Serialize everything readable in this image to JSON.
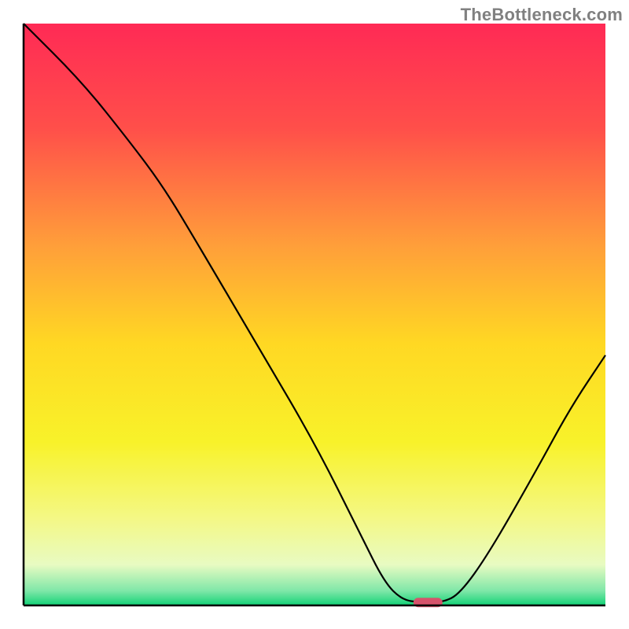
{
  "watermark": "TheBottleneck.com",
  "chart_data": {
    "type": "line",
    "title": "",
    "xlabel": "",
    "ylabel": "",
    "xlim": [
      0,
      100
    ],
    "ylim": [
      0,
      100
    ],
    "grid": false,
    "legend": false,
    "background_gradient": [
      {
        "stop": 0.0,
        "color": "#ff2a55"
      },
      {
        "stop": 0.18,
        "color": "#ff4f4a"
      },
      {
        "stop": 0.38,
        "color": "#ff9e3a"
      },
      {
        "stop": 0.55,
        "color": "#ffd823"
      },
      {
        "stop": 0.72,
        "color": "#f8f22a"
      },
      {
        "stop": 0.85,
        "color": "#f4f885"
      },
      {
        "stop": 0.93,
        "color": "#e8fbc2"
      },
      {
        "stop": 0.975,
        "color": "#7fe7a8"
      },
      {
        "stop": 1.0,
        "color": "#11d276"
      }
    ],
    "series": [
      {
        "name": "bottleneck-curve",
        "type": "line",
        "color": "#000000",
        "points": [
          {
            "x": 0,
            "y": 100
          },
          {
            "x": 10,
            "y": 90
          },
          {
            "x": 18,
            "y": 80
          },
          {
            "x": 24,
            "y": 72
          },
          {
            "x": 30,
            "y": 62
          },
          {
            "x": 40,
            "y": 45
          },
          {
            "x": 50,
            "y": 28
          },
          {
            "x": 58,
            "y": 12
          },
          {
            "x": 62,
            "y": 4
          },
          {
            "x": 65,
            "y": 1
          },
          {
            "x": 68,
            "y": 0.5
          },
          {
            "x": 72,
            "y": 0.5
          },
          {
            "x": 75,
            "y": 2
          },
          {
            "x": 80,
            "y": 9
          },
          {
            "x": 88,
            "y": 23
          },
          {
            "x": 94,
            "y": 34
          },
          {
            "x": 100,
            "y": 43
          }
        ]
      }
    ],
    "marker": {
      "name": "optimal-point",
      "shape": "rounded-rect",
      "color": "#d6536b",
      "center_x": 69.5,
      "y": 0.5,
      "width": 5,
      "height": 1.6
    },
    "axes": {
      "left": {
        "color": "#000000",
        "visible": true
      },
      "bottom": {
        "color": "#000000",
        "visible": true
      },
      "top": {
        "visible": false
      },
      "right": {
        "visible": false
      }
    }
  }
}
